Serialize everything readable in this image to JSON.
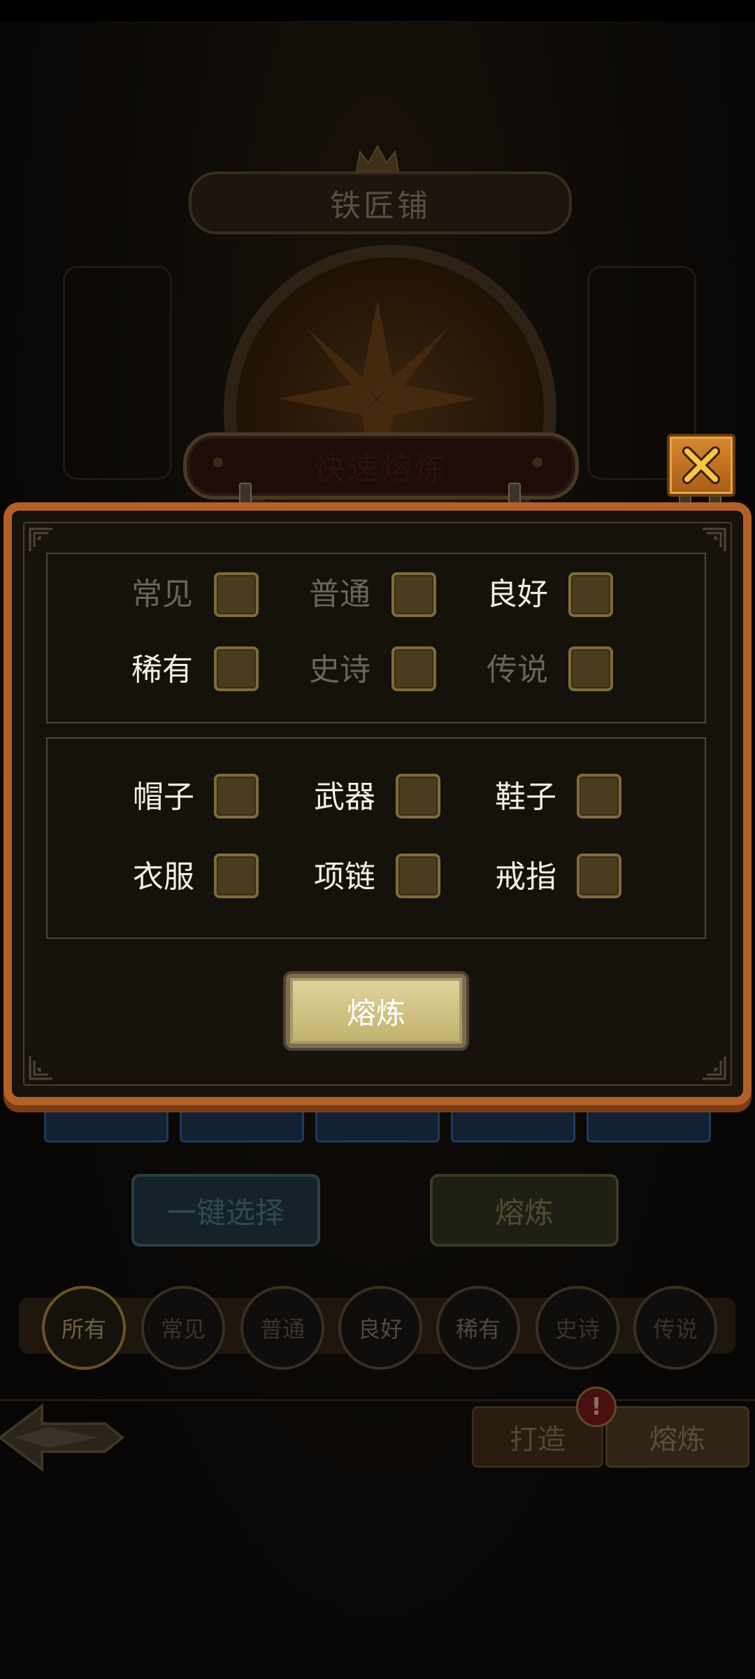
{
  "background": {
    "shop_title": "铁匠铺",
    "one_click_select": "一键选择",
    "smelt_button": "熔炼",
    "rarity_tabs": [
      "所有",
      "常见",
      "普通",
      "良好",
      "稀有",
      "史诗",
      "传说"
    ],
    "bottom_tabs": {
      "forge": "打造",
      "smelt": "熔炼"
    },
    "alert_badge": "!"
  },
  "dialog": {
    "title": "快速熔炼",
    "rarity_options": [
      {
        "label": "常见",
        "checked": false,
        "label_dim": true
      },
      {
        "label": "普通",
        "checked": false,
        "label_dim": true
      },
      {
        "label": "良好",
        "checked": false,
        "label_dim": false
      },
      {
        "label": "稀有",
        "checked": false,
        "label_dim": false
      },
      {
        "label": "史诗",
        "checked": false,
        "label_dim": true
      },
      {
        "label": "传说",
        "checked": false,
        "label_dim": true
      }
    ],
    "equipment_options": [
      {
        "label": "帽子",
        "checked": false
      },
      {
        "label": "武器",
        "checked": false
      },
      {
        "label": "鞋子",
        "checked": false
      },
      {
        "label": "衣服",
        "checked": false
      },
      {
        "label": "项链",
        "checked": false
      },
      {
        "label": "戒指",
        "checked": false
      }
    ],
    "confirm_label": "熔炼"
  },
  "colors": {
    "panel_border": "#b25f28",
    "checkbox_fill": "#4a3c1e",
    "confirm_button": "#d4c785",
    "close_button": "#d9892e"
  }
}
